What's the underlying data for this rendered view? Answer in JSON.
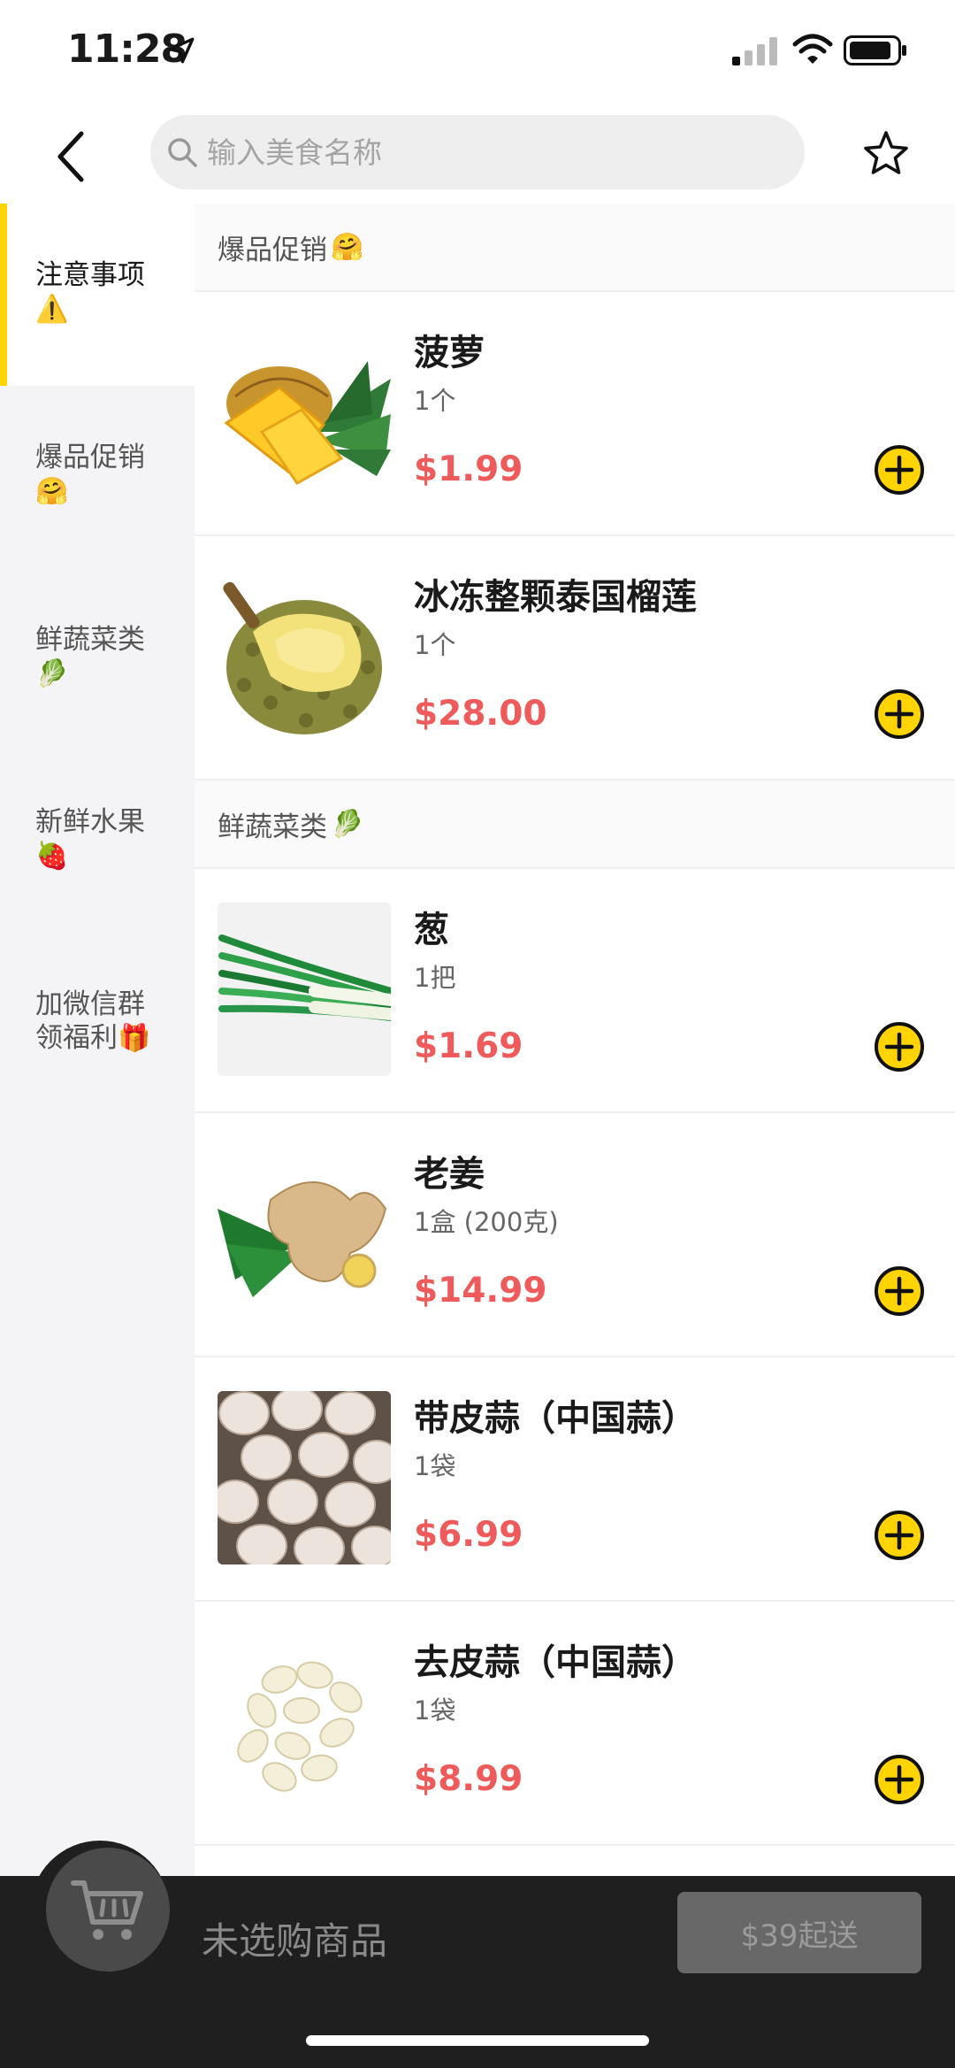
{
  "status_bar": {
    "time": "11:28"
  },
  "header": {
    "search_placeholder": "输入美食名称"
  },
  "sidebar": {
    "items": [
      {
        "label": "注意事项",
        "label2": "",
        "emoji": "⚠️",
        "active": true
      },
      {
        "label": "爆品促销",
        "label2": "",
        "emoji": "🤗",
        "active": false
      },
      {
        "label": "鲜蔬菜类",
        "label2": "",
        "emoji": "🥬",
        "active": false
      },
      {
        "label": "新鲜水果",
        "label2": "",
        "emoji": "🍓",
        "active": false
      },
      {
        "label": "加微信群",
        "label2": "领福利",
        "emoji": "🎁",
        "active": false
      }
    ]
  },
  "sections": [
    {
      "title": "爆品促销",
      "emoji": "🤗",
      "products": [
        {
          "name": "菠萝",
          "unit": "1个",
          "price": "$1.99",
          "image": "pineapple"
        },
        {
          "name": "冰冻整颗泰国榴莲",
          "unit": "1个",
          "price": "$28.00",
          "image": "durian"
        }
      ]
    },
    {
      "title": "鲜蔬菜类",
      "emoji": "🥬",
      "products": [
        {
          "name": "葱",
          "unit": "1把",
          "price": "$1.69",
          "image": "scallion"
        },
        {
          "name": "老姜",
          "unit": "1盒 (200克)",
          "price": "$14.99",
          "image": "ginger"
        },
        {
          "name": "带皮蒜（中国蒜）",
          "unit": "1袋",
          "price": "$6.99",
          "image": "garlic"
        },
        {
          "name": "去皮蒜（中国蒜）",
          "unit": "1袋",
          "price": "$8.99",
          "image": "peeled-garlic"
        }
      ]
    }
  ],
  "cart": {
    "empty_text": "未选购商品",
    "checkout_label": "$39起送"
  },
  "colors": {
    "accent": "#ffd400",
    "price": "#ef5a5a",
    "cartbar": "#1f1f1f"
  }
}
